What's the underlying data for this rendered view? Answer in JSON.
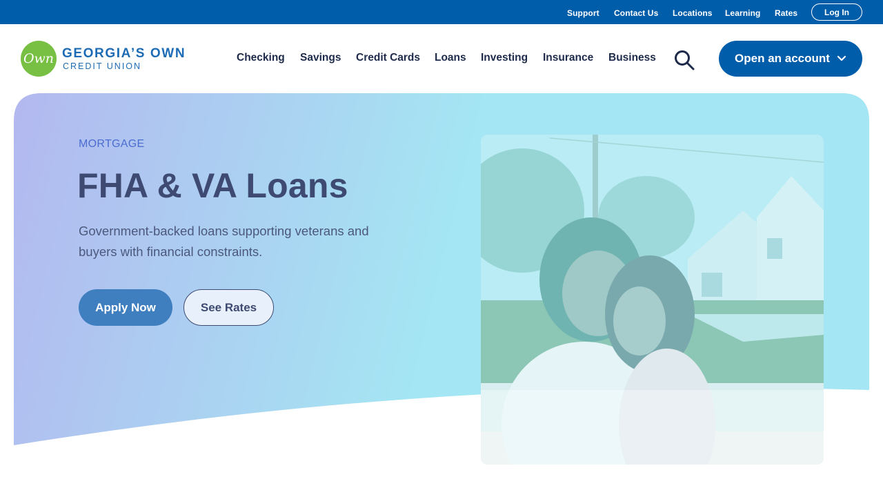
{
  "utility_nav": {
    "links": [
      "Support",
      "Contact Us",
      "Locations",
      "Learning",
      "Rates"
    ],
    "login_label": "Log In"
  },
  "brand": {
    "logo_mark": "Own",
    "name_line1": "GEORGIA’S OWN",
    "name_line2": "CREDIT UNION"
  },
  "main_nav": {
    "items": [
      "Checking",
      "Savings",
      "Credit Cards",
      "Loans",
      "Investing",
      "Insurance",
      "Business"
    ],
    "search_icon": "search-icon",
    "cta_label": "Open an account",
    "cta_icon": "chevron-down-icon"
  },
  "hero": {
    "eyebrow": "MORTGAGE",
    "title": "FHA & VA Loans",
    "description": "Government-backed loans supporting veterans and buyers with financial constraints.",
    "primary_button": "Apply Now",
    "secondary_button": "See Rates",
    "image_alt": "hero-photo"
  },
  "colors": {
    "brand_blue": "#005daa",
    "logo_green": "#78c043",
    "hero_gradient_start": "#b3b8ef",
    "hero_gradient_end": "#a4e6f3",
    "title_text": "#3e4a72"
  }
}
